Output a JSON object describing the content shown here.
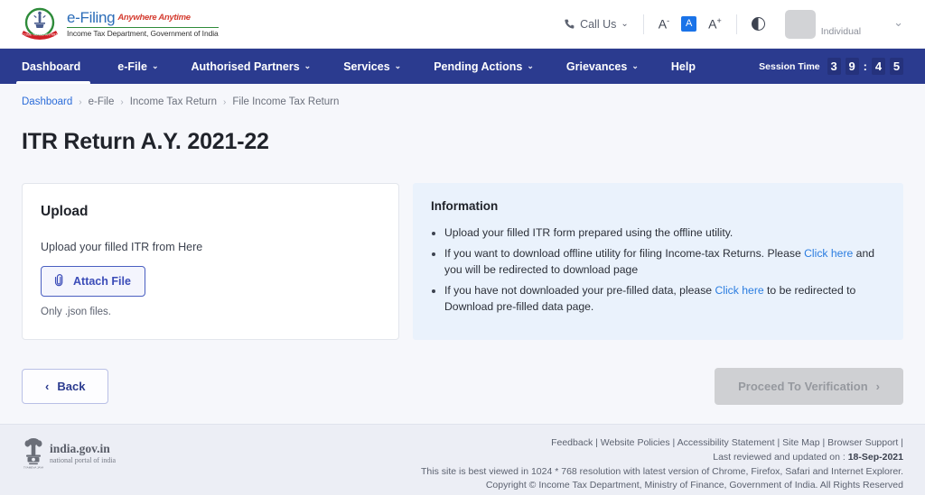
{
  "header": {
    "logo_alt": "income-tax-department-emblem",
    "brand_main": "e-Filing",
    "brand_tagline": "Anywhere Anytime",
    "brand_sub": "Income Tax Department, Government of India",
    "call_us": "Call Us",
    "font_decrease": "A",
    "font_decrease_sup": "-",
    "font_normal": "A",
    "font_increase": "A",
    "font_increase_sup": "+",
    "contrast_icon": "contrast-icon",
    "user_label": "Individual",
    "accent_blue": "#1a73e8"
  },
  "nav": {
    "items": [
      {
        "label": "Dashboard",
        "caret": "",
        "active": true
      },
      {
        "label": "e-File",
        "caret": "⌄",
        "active": false
      },
      {
        "label": "Authorised Partners",
        "caret": "⌄",
        "active": false
      },
      {
        "label": "Services",
        "caret": "⌄",
        "active": false
      },
      {
        "label": "Pending Actions",
        "caret": "⌄",
        "active": false
      },
      {
        "label": "Grievances",
        "caret": "⌄",
        "active": false
      },
      {
        "label": "Help",
        "caret": "",
        "active": false
      }
    ],
    "session_label": "Session Time",
    "session_digits": [
      "3",
      "9",
      "4",
      "5"
    ],
    "session_colon": ":",
    "navbar_color": "#2b3b8f"
  },
  "breadcrumb": {
    "items": [
      "Dashboard",
      "e-File",
      "Income Tax Return",
      "File Income Tax Return"
    ],
    "separator": "›"
  },
  "page": {
    "title": "ITR Return A.Y. 2021-22"
  },
  "upload_card": {
    "title": "Upload",
    "subtitle": "Upload your filled ITR from Here",
    "attach_button": "Attach File",
    "attach_icon": "paperclip-icon",
    "hint": "Only .json files."
  },
  "info_card": {
    "title": "Information",
    "bullets": [
      {
        "parts": [
          {
            "text": "Upload your filled ITR form prepared using the offline utility.",
            "link": false
          }
        ]
      },
      {
        "parts": [
          {
            "text": "If you want to download offline utility for filing Income-tax Returns. Please ",
            "link": false
          },
          {
            "text": "Click here",
            "link": true
          },
          {
            "text": " and you will be redirected to download page",
            "link": false
          }
        ]
      },
      {
        "parts": [
          {
            "text": "If you have not downloaded your pre-filled data, please ",
            "link": false
          },
          {
            "text": "Click here",
            "link": true
          },
          {
            "text": " to be redirected to Download pre-filled data page.",
            "link": false
          }
        ]
      }
    ],
    "panel_color": "#eaf2fc",
    "link_color": "#2b7de0"
  },
  "actions": {
    "back_label": "Back",
    "back_icon": "chevron-left-icon",
    "proceed_label": "Proceed To Verification",
    "proceed_icon": "chevron-right-icon",
    "proceed_disabled": true
  },
  "footer": {
    "gov_title": "india.gov.in",
    "gov_sub": "national portal of india",
    "gov_emblem": "ashoka-emblem",
    "links": [
      "Feedback",
      "Website Policies",
      "Accessibility Statement",
      "Site Map",
      "Browser Support"
    ],
    "links_separator": " | ",
    "links_trailing": " |",
    "reviewed_prefix": "Last reviewed and updated on : ",
    "reviewed_date": "18-Sep-2021",
    "best_viewed": "This site is best viewed in 1024 * 768 resolution with latest version of Chrome, Firefox, Safari and Internet Explorer.",
    "copyright": "Copyright © Income Tax Department, Ministry of Finance, Government of India. All Rights Reserved"
  }
}
